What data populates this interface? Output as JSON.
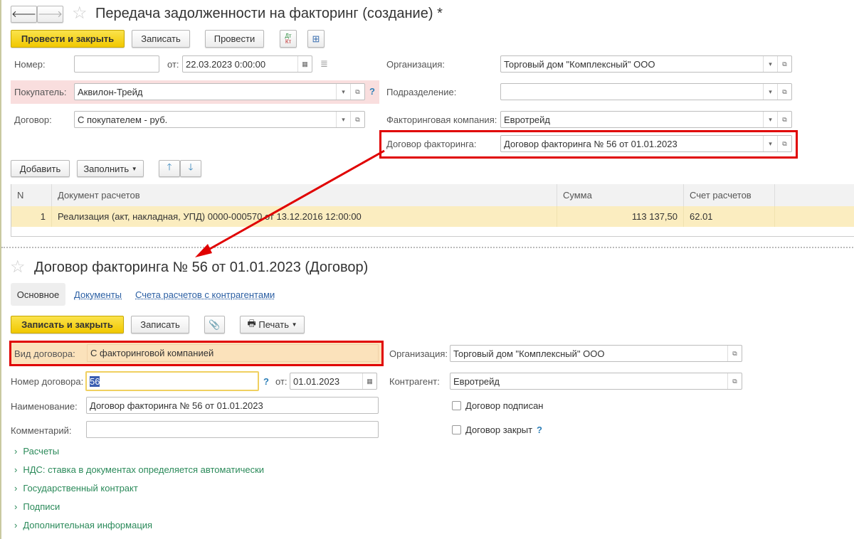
{
  "doc": {
    "title": "Передача задолженности на факторинг (создание) *",
    "toolbar": {
      "post_close": "Провести и закрыть",
      "save": "Записать",
      "post": "Провести",
      "dtkt_dt": "Дт",
      "dtkt_kt": "Кт"
    },
    "fields": {
      "number_label": "Номер:",
      "number_value": "",
      "date_label": "от:",
      "date_value": "22.03.2023  0:00:00",
      "buyer_label": "Покупатель:",
      "buyer_value": "Аквилон-Трейд",
      "contract_label": "Договор:",
      "contract_value": "С покупателем - руб.",
      "org_label": "Организация:",
      "org_value": "Торговый дом \"Комплексный\" ООО",
      "dept_label": "Подразделение:",
      "dept_value": "",
      "factor_label": "Факторинговая компания:",
      "factor_value": "Евротрейд",
      "factor_contract_label": "Договор факторинга:",
      "factor_contract_value": "Договор факторинга № 56 от 01.01.2023",
      "help": "?"
    },
    "table_toolbar": {
      "add": "Добавить",
      "fill": "Заполнить"
    },
    "table": {
      "headers": [
        "N",
        "Документ расчетов",
        "Сумма",
        "Счет расчетов"
      ],
      "rows": [
        [
          "1",
          "Реализация (акт, накладная, УПД) 0000-000570 от 13.12.2016 12:00:00",
          "113 137,50",
          "62.01"
        ]
      ]
    }
  },
  "contract": {
    "title": "Договор факторинга № 56 от 01.01.2023 (Договор)",
    "tabs": [
      "Основное",
      "Документы",
      "Счета расчетов с контрагентами"
    ],
    "toolbar": {
      "save_close": "Записать и закрыть",
      "save": "Записать",
      "print": "Печать"
    },
    "fields": {
      "kind_label": "Вид договора:",
      "kind_value": "С факторинговой компанией",
      "num_label": "Номер договора:",
      "num_value": "56",
      "help": "?",
      "date_label": "от:",
      "date_value": "01.01.2023",
      "name_label": "Наименование:",
      "name_value": "Договор факторинга № 56 от 01.01.2023",
      "comment_label": "Комментарий:",
      "comment_value": "",
      "org_label": "Организация:",
      "org_value": "Торговый дом \"Комплексный\" ООО",
      "cp_label": "Контрагент:",
      "cp_value": "Евротрейд",
      "signed_label": "Договор подписан",
      "closed_label": "Договор закрыт"
    },
    "groups": [
      "Расчеты",
      "НДС: ставка в документах определяется автоматически",
      "Государственный контракт",
      "Подписи",
      "Дополнительная информация"
    ]
  },
  "colors": {
    "highlight": "#e00000",
    "accent": "#f5d000"
  }
}
